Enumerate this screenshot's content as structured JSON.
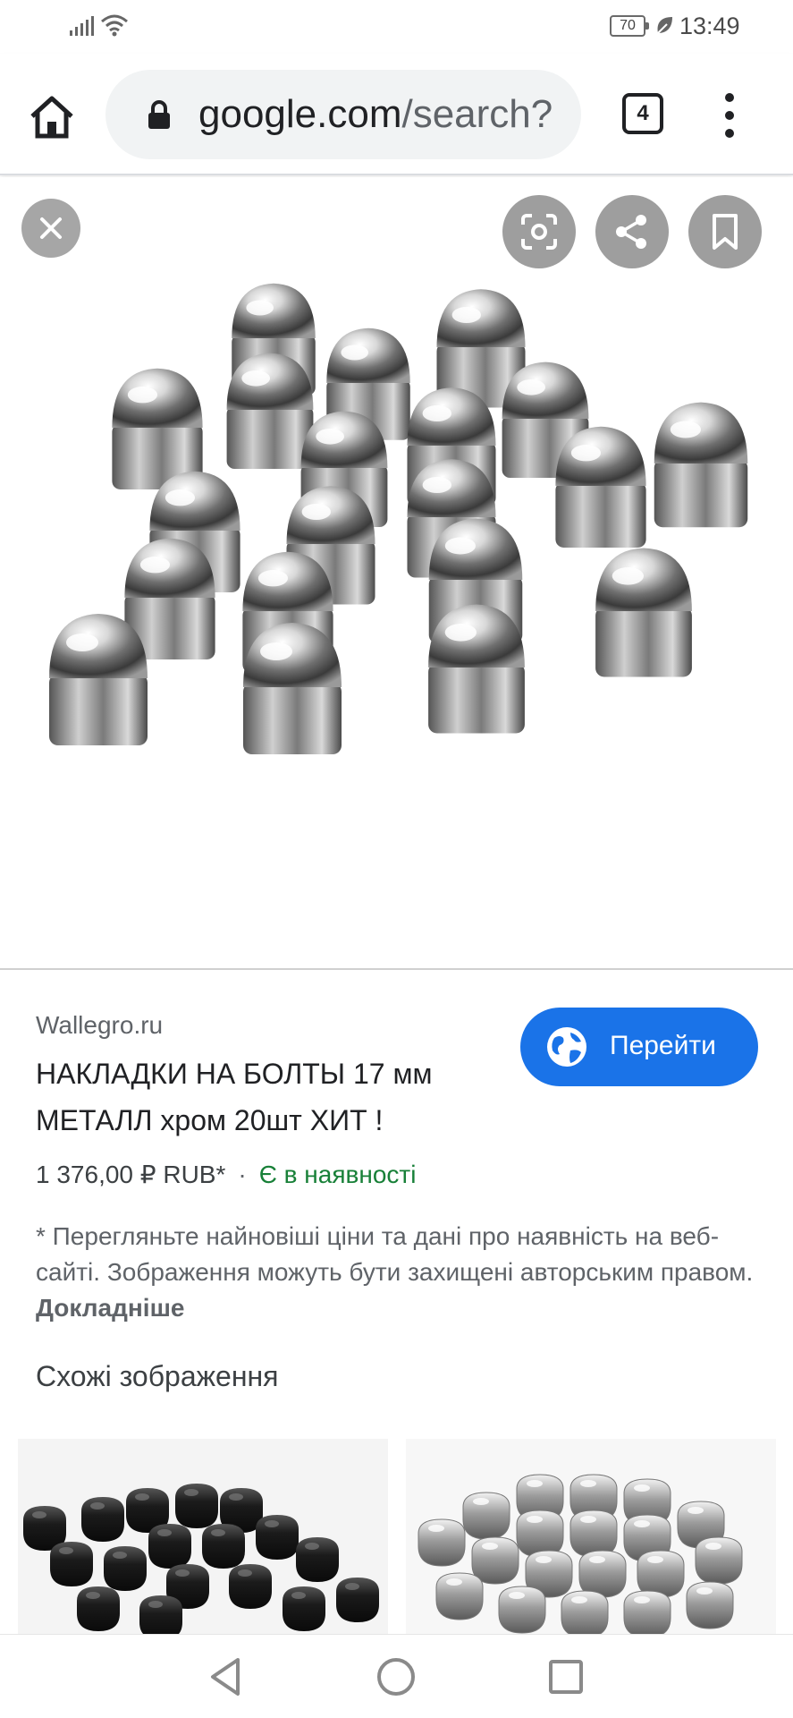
{
  "status_bar": {
    "time": "13:49",
    "battery": "70",
    "icons": [
      "signal-icon",
      "wifi-icon",
      "battery-icon",
      "leaf-icon"
    ]
  },
  "browser": {
    "url_host": "google.com",
    "url_path": "/search?",
    "tab_count": "4",
    "icons": [
      "home-icon",
      "lock-icon",
      "tabs-icon",
      "more-vert-icon"
    ]
  },
  "viewer": {
    "icons": [
      "close-icon",
      "lens-icon",
      "share-icon",
      "bookmark-icon"
    ]
  },
  "result": {
    "source": "Wallegro.ru",
    "title": "НАКЛАДКИ НА БОЛТЫ 17 мм МЕТАЛЛ хром 20шт ХИТ !",
    "visit_label": "Перейти",
    "price": "1 376,00 ₽ RUB*",
    "separator": "·",
    "availability": "Є в наявності",
    "disclaimer": "* Перегляньте найновіші ціни та дані про наявність на веб-сайті. Зображення можуть бути захищені авторським правом.",
    "more_link": "Докладніше"
  },
  "similar": {
    "title": "Схожі зображення"
  },
  "colors": {
    "accent": "#1a73e8",
    "in_stock": "#188038"
  }
}
